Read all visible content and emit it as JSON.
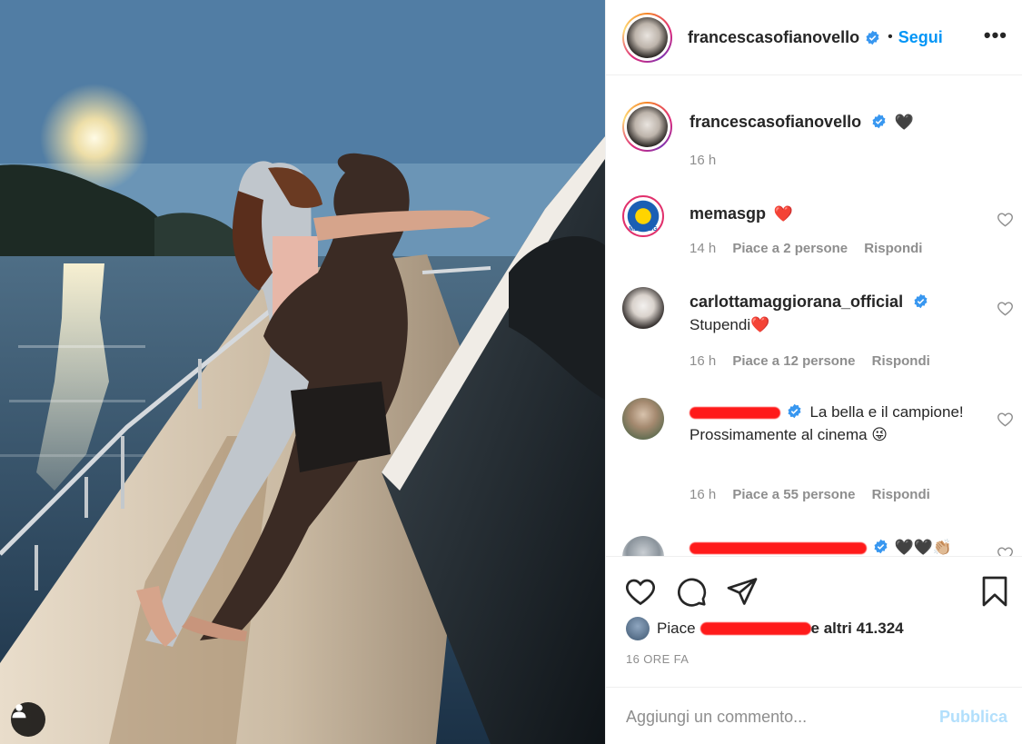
{
  "post": {
    "author": "francescasofianovello",
    "follow_label": "Segui",
    "dot": "•",
    "more_label": "•••",
    "caption_emoji": "🖤",
    "caption_time": "16 h"
  },
  "comments": [
    {
      "user": "memasgp",
      "text": "❤️",
      "time": "14 h",
      "likes": "Piace a 2 persone",
      "reply": "Rispondi",
      "avatar_label": "MEMASG"
    },
    {
      "user": "carlottamaggiorana_official",
      "text": "Stupendi❤️",
      "time": "16 h",
      "likes": "Piace a 12 persone",
      "reply": "Rispondi"
    },
    {
      "user": "",
      "text": "La bella e il campione! Prossimamente al cinema 😜",
      "time": "16 h",
      "likes": "Piace a 55 persone",
      "reply": "Rispondi"
    },
    {
      "user": "",
      "text": "🖤🖤👏🏼"
    }
  ],
  "likes_line": {
    "prefix": "Piace",
    "suffix": "e altri 41.324"
  },
  "timestamp": "16 ORE FA",
  "add_comment": {
    "placeholder": "Aggiungi un commento...",
    "publish_label": "Pubblica"
  },
  "colors": {
    "accent": "#0095f6",
    "publish_disabled": "#b2dffc",
    "verified": "#3897f0",
    "heart_red": "#ed4956",
    "redaction": "#ff1a1a"
  },
  "icons": [
    "verified-icon",
    "heart-icon",
    "comment-icon",
    "share-icon",
    "bookmark-icon",
    "more-icon",
    "user-tag-icon"
  ]
}
